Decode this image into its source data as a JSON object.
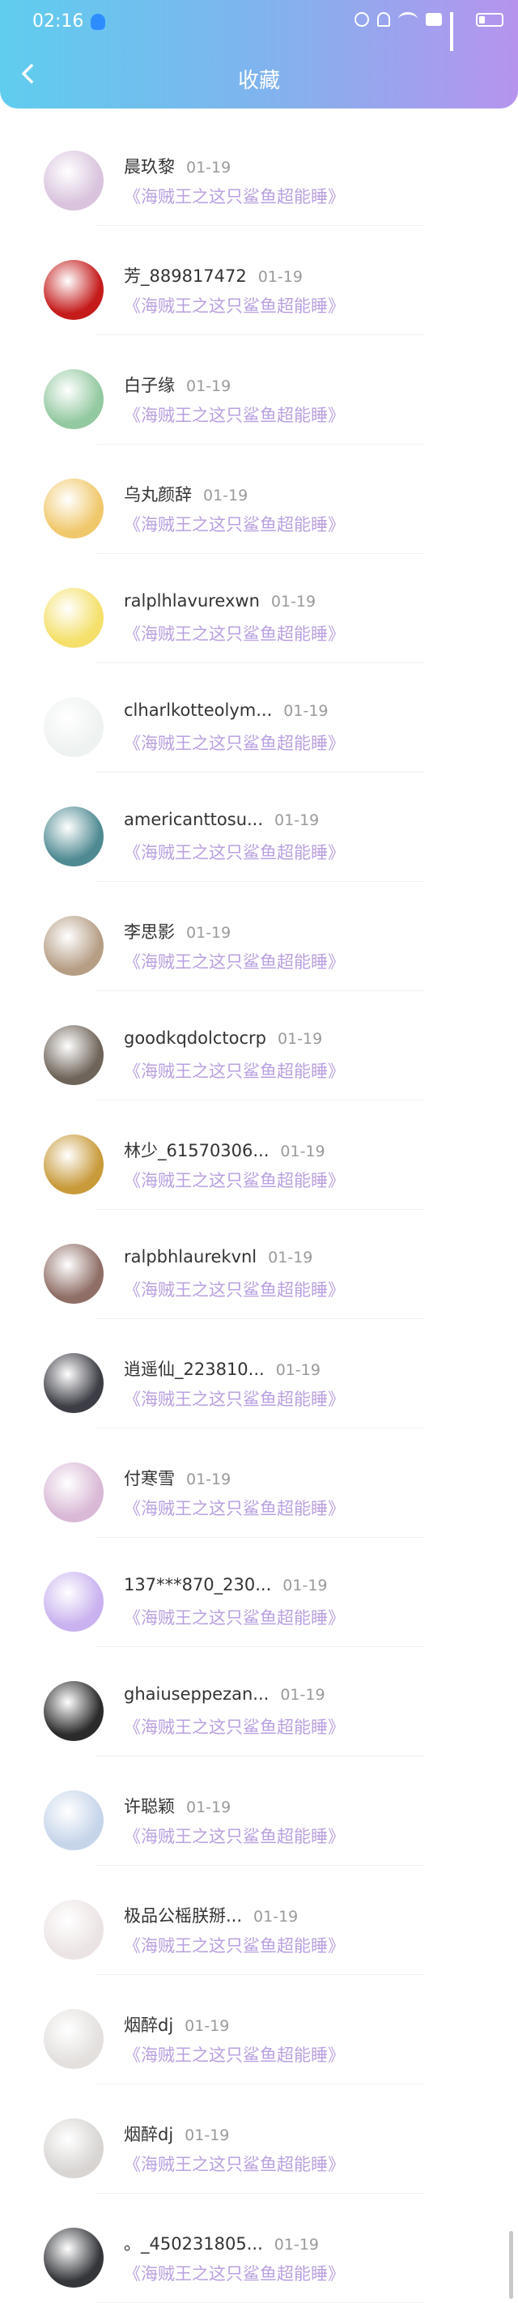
{
  "status": {
    "time": "02:16"
  },
  "header": {
    "title": "收藏"
  },
  "favorites": [
    {
      "name": "晨玖黎",
      "date": "01-19",
      "work": "《海贼王之这只鲨鱼超能睡》",
      "av": "#d9c3dd"
    },
    {
      "name": "芳_889817472",
      "date": "01-19",
      "work": "《海贼王之这只鲨鱼超能睡》",
      "av": "#c51b1b"
    },
    {
      "name": "白子缘",
      "date": "01-19",
      "work": "《海贼王之这只鲨鱼超能睡》",
      "av": "#93c9a0"
    },
    {
      "name": "乌丸颜辞",
      "date": "01-19",
      "work": "《海贼王之这只鲨鱼超能睡》",
      "av": "#f0c86c"
    },
    {
      "name": "ralplhlavurexwn",
      "date": "01-19",
      "work": "《海贼王之这只鲨鱼超能睡》",
      "av": "#f4e06a"
    },
    {
      "name": "clharlkotteolym...",
      "date": "01-19",
      "work": "《海贼王之这只鲨鱼超能睡》",
      "av": "#eef2f0"
    },
    {
      "name": "americanttosu...",
      "date": "01-19",
      "work": "《海贼王之这只鲨鱼超能睡》",
      "av": "#4f8a92"
    },
    {
      "name": "李思影",
      "date": "01-19",
      "work": "《海贼王之这只鲨鱼超能睡》",
      "av": "#b69e85"
    },
    {
      "name": "goodkqdolctocrp",
      "date": "01-19",
      "work": "《海贼王之这只鲨鱼超能睡》",
      "av": "#6e6459"
    },
    {
      "name": "林少_61570306...",
      "date": "01-19",
      "work": "《海贼王之这只鲨鱼超能睡》",
      "av": "#c89a3a"
    },
    {
      "name": "ralpbhlaurekvnl",
      "date": "01-19",
      "work": "《海贼王之这只鲨鱼超能睡》",
      "av": "#8f6e66"
    },
    {
      "name": "逍遥仙_223810...",
      "date": "01-19",
      "work": "《海贼王之这只鲨鱼超能睡》",
      "av": "#3c3d45"
    },
    {
      "name": "付寒雪",
      "date": "01-19",
      "work": "《海贼王之这只鲨鱼超能睡》",
      "av": "#d9b9d6"
    },
    {
      "name": "137***870_230...",
      "date": "01-19",
      "work": "《海贼王之这只鲨鱼超能睡》",
      "av": "#c9b2ef"
    },
    {
      "name": "ghaiuseppezan...",
      "date": "01-19",
      "work": "《海贼王之这只鲨鱼超能睡》",
      "av": "#2b2b2b"
    },
    {
      "name": "许聪颖",
      "date": "01-19",
      "work": "《海贼王之这只鲨鱼超能睡》",
      "av": "#c6d5ea"
    },
    {
      "name": "极品公榣朕掰...",
      "date": "01-19",
      "work": "《海贼王之这只鲨鱼超能睡》",
      "av": "#ece4e4"
    },
    {
      "name": "烟醉dj",
      "date": "01-19",
      "work": "《海贼王之这只鲨鱼超能睡》",
      "av": "#e3e0de"
    },
    {
      "name": "烟醉dj",
      "date": "01-19",
      "work": "《海贼王之这只鲨鱼超能睡》",
      "av": "#d8d5d3"
    },
    {
      "name": "。_450231805...",
      "date": "01-19",
      "work": "《海贼王之这只鲨鱼超能睡》",
      "av": "#34363a"
    }
  ],
  "icons": {
    "back": "chevron-left-icon",
    "notification": "qq-icon"
  },
  "colors": {
    "header_start": "#5fcdee",
    "header_end": "#b694ee",
    "work_title": "#b9a0e0"
  }
}
